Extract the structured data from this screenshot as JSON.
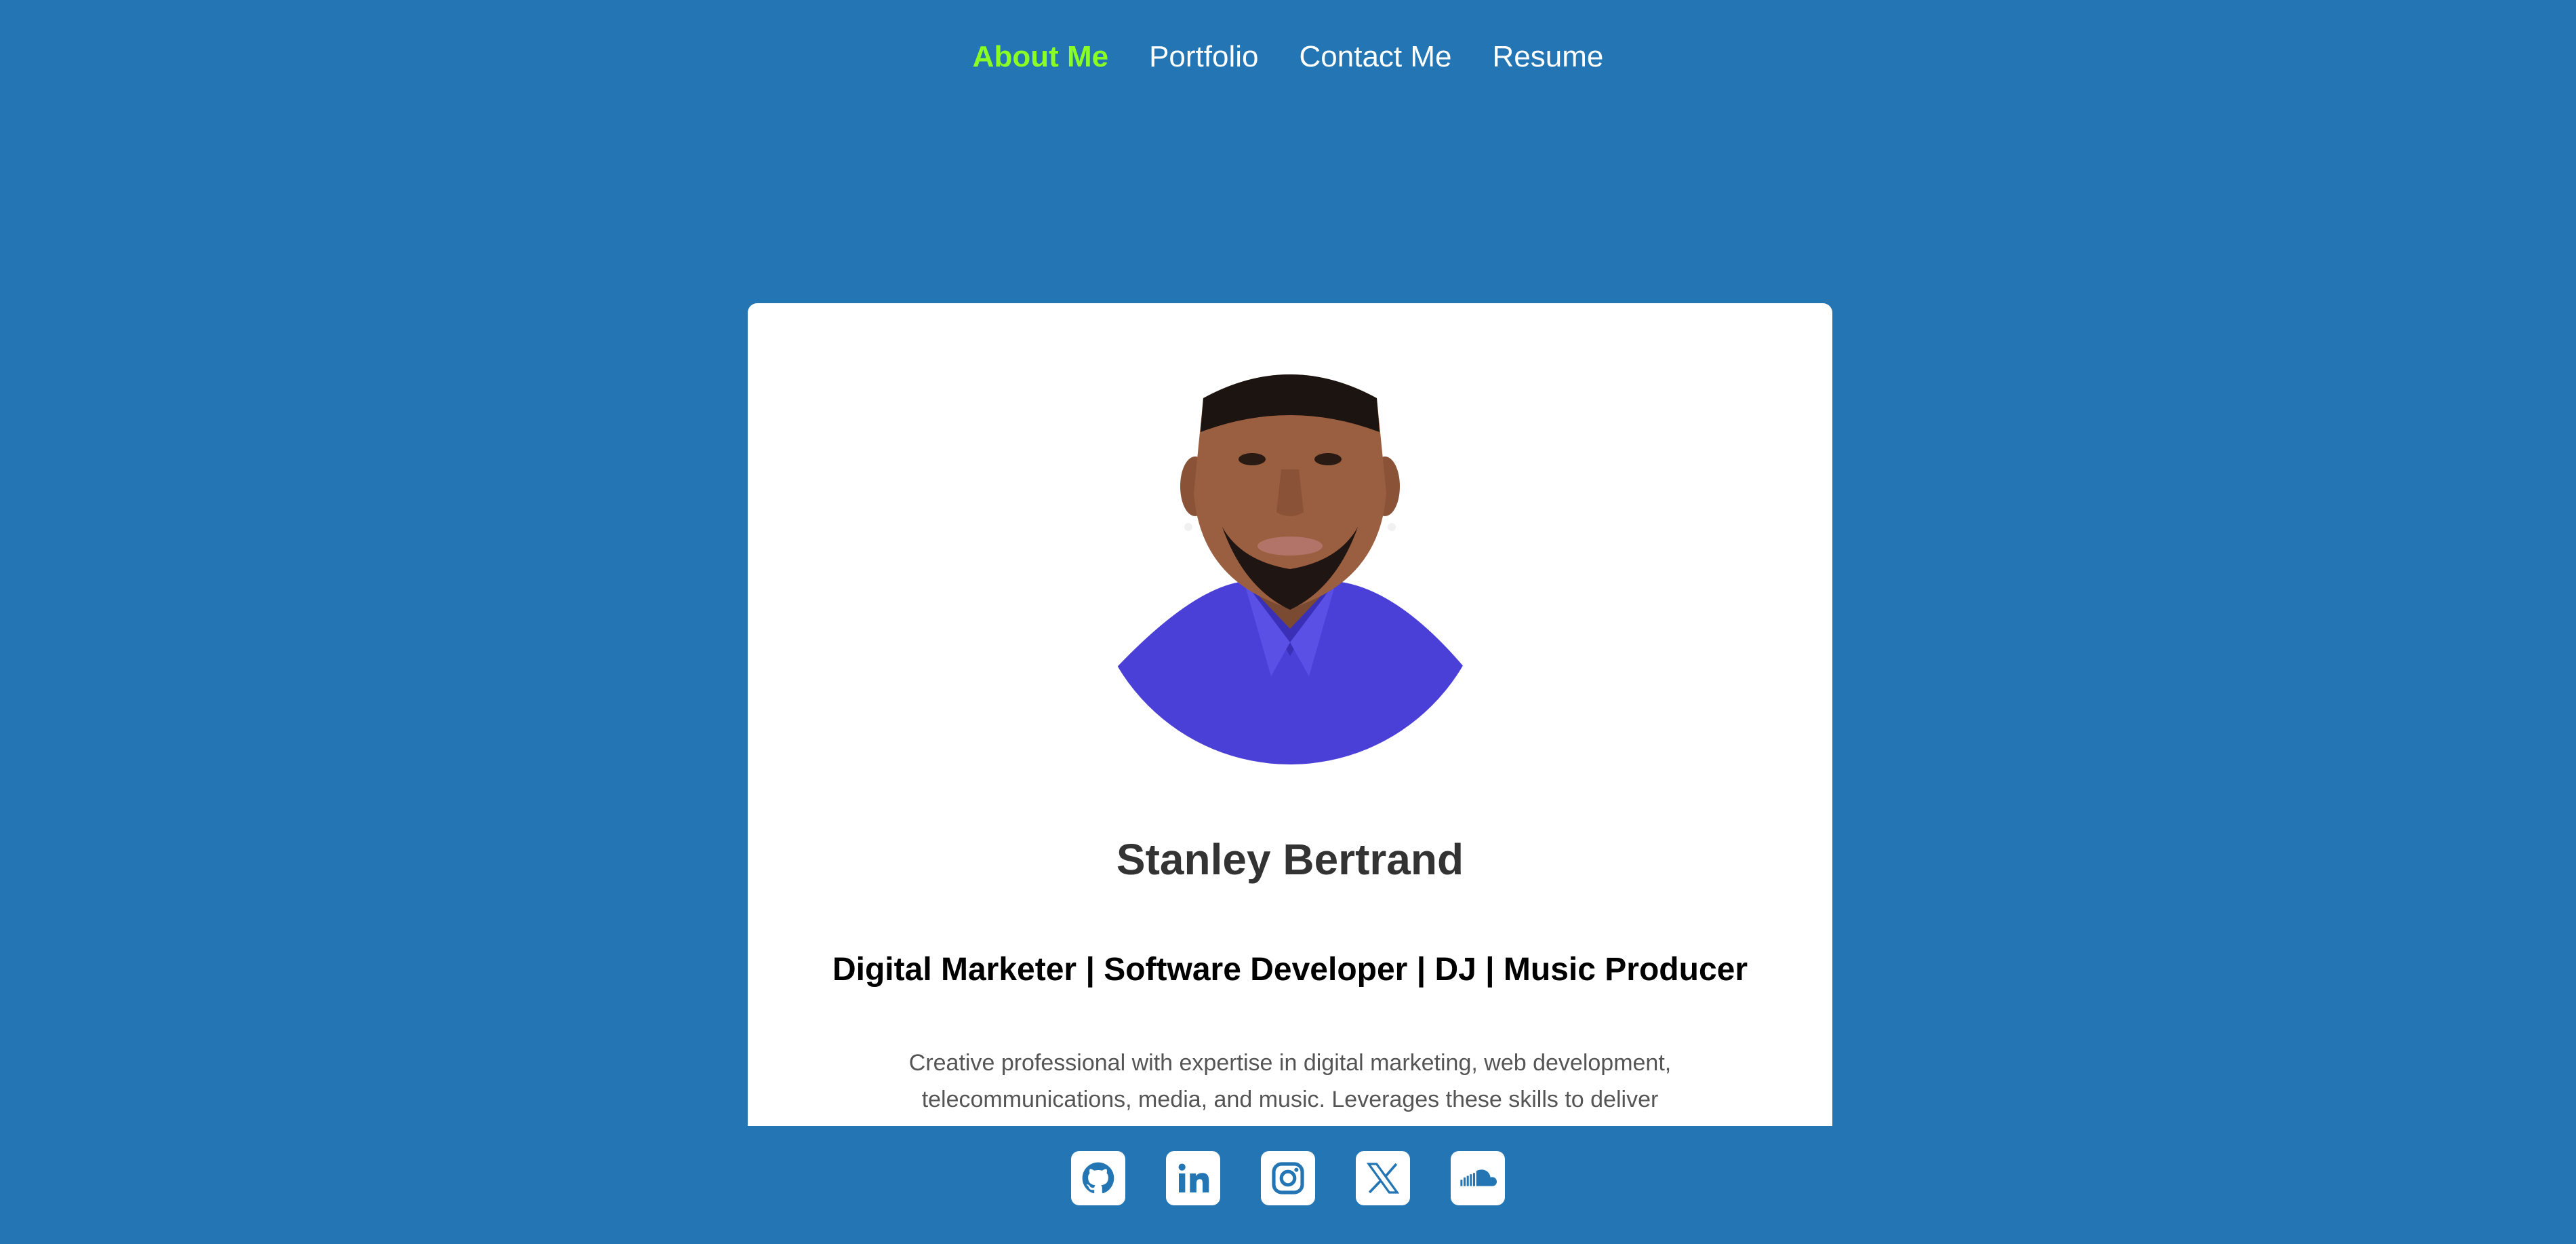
{
  "nav": {
    "items": [
      {
        "label": "About Me",
        "active": true
      },
      {
        "label": "Portfolio",
        "active": false
      },
      {
        "label": "Contact Me",
        "active": false
      },
      {
        "label": "Resume",
        "active": false
      }
    ]
  },
  "profile": {
    "name": "Stanley Bertrand",
    "subtitle": "Digital Marketer | Software Developer | DJ | Music Producer",
    "bio": "Creative professional with expertise in digital marketing, web development, telecommunications, media, and music. Leverages these skills to deliver"
  },
  "social": {
    "icons": [
      "github-icon",
      "linkedin-icon",
      "instagram-icon",
      "x-icon",
      "soundcloud-icon"
    ]
  },
  "colors": {
    "background": "#2475b3",
    "nav_active": "#8aff24",
    "card": "#ffffff",
    "shirt": "#4a3fd6",
    "icon": "#2475b3"
  }
}
